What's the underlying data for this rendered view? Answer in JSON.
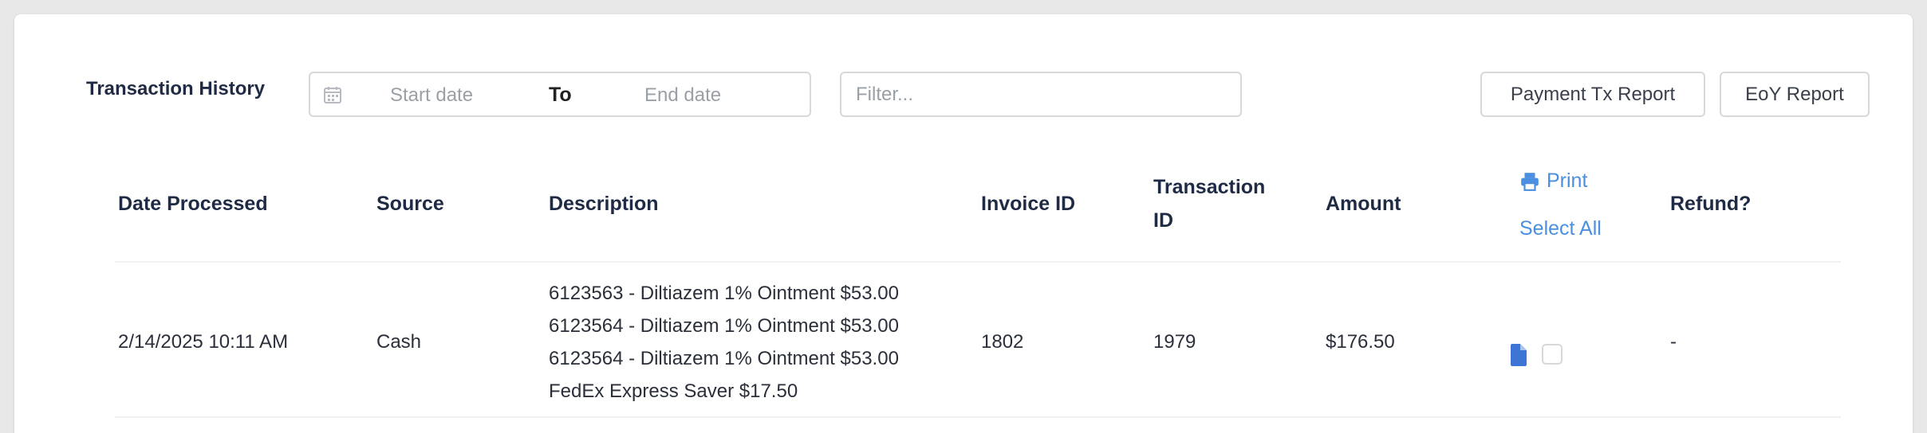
{
  "header": {
    "title": "Transaction History",
    "start_date_placeholder": "Start date",
    "to_label": "To",
    "end_date_placeholder": "End date",
    "filter_placeholder": "Filter...",
    "payment_report_label": "Payment Tx Report",
    "eoy_report_label": "EoY Report"
  },
  "table": {
    "columns": {
      "date_processed": "Date Processed",
      "source": "Source",
      "description": "Description",
      "invoice_id": "Invoice ID",
      "transaction_id_line1": "Transaction",
      "transaction_id_line2": "ID",
      "amount": "Amount",
      "print": "Print",
      "select_all": "Select All",
      "refund": "Refund?"
    },
    "rows": [
      {
        "date_processed": "2/14/2025 10:11 AM",
        "source": "Cash",
        "description": [
          "6123563 - Diltiazem 1% Ointment $53.00",
          "6123564 - Diltiazem 1% Ointment $53.00",
          "6123564 - Diltiazem 1% Ointment $53.00",
          "FedEx Express Saver $17.50"
        ],
        "invoice_id": "1802",
        "transaction_id": "1979",
        "amount": "$176.50",
        "refund": "-"
      }
    ]
  },
  "icons": {
    "calendar": "calendar-icon",
    "printer": "printer-icon",
    "document": "document-icon"
  },
  "colors": {
    "accent": "#4a8fe0",
    "doc_icon": "#3d74d6",
    "heading": "#1f2a44",
    "border": "#d6d8dc"
  }
}
